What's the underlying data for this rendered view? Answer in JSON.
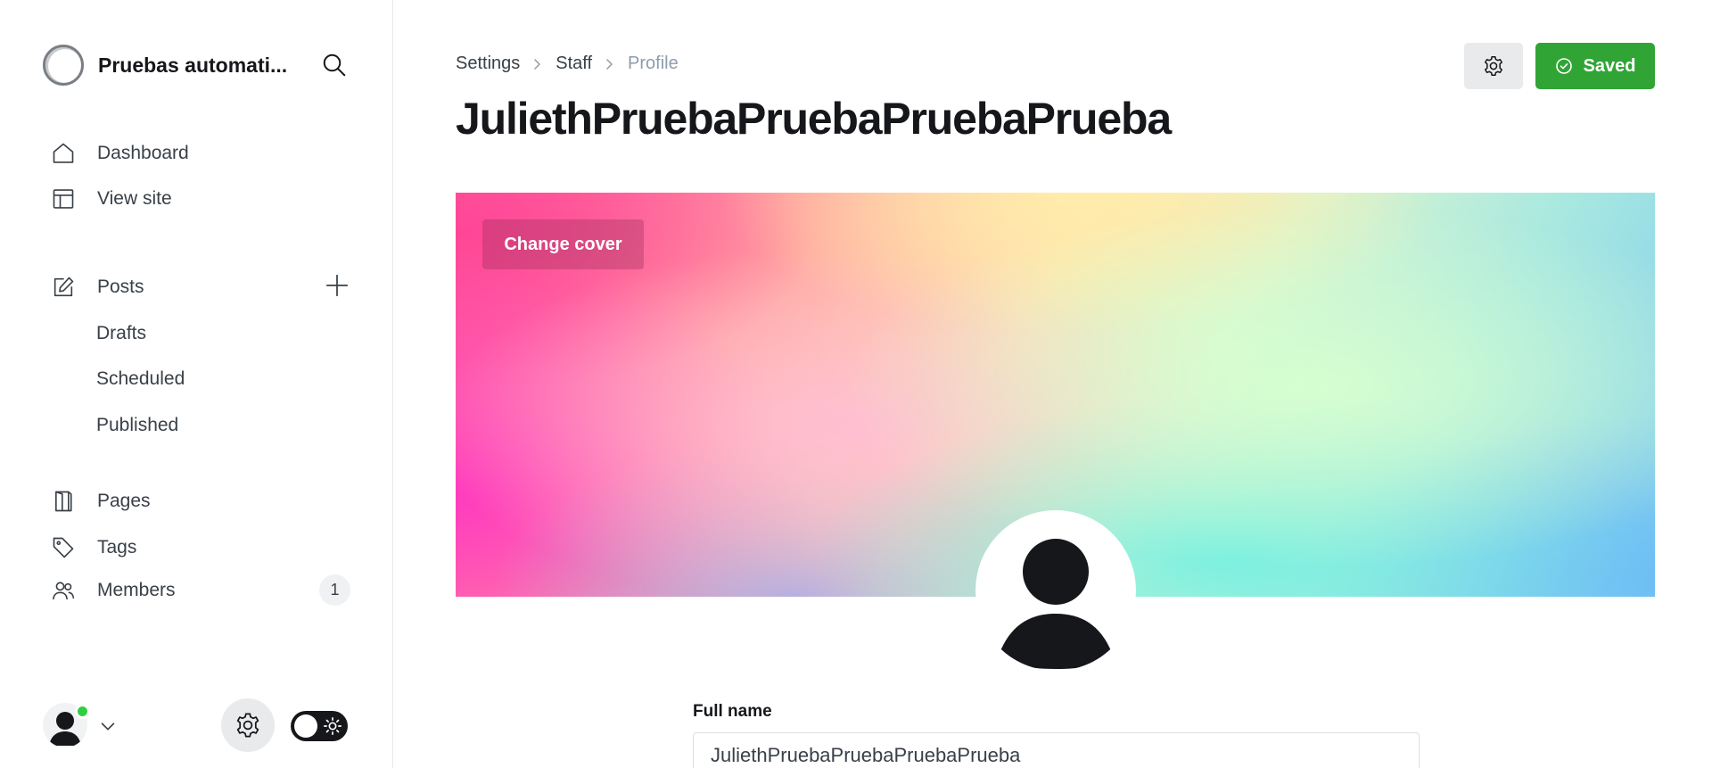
{
  "sidebar": {
    "brand_name": "Pruebas automati...",
    "nav": {
      "dashboard": "Dashboard",
      "view_site": "View site",
      "posts": "Posts",
      "drafts": "Drafts",
      "scheduled": "Scheduled",
      "published": "Published",
      "pages": "Pages",
      "tags": "Tags",
      "members": "Members",
      "members_count": "1"
    },
    "icons": {
      "search": "search-icon",
      "dashboard": "home-icon",
      "view_site": "layout-icon",
      "posts": "edit-icon",
      "add": "plus-icon",
      "pages": "page-icon",
      "tags": "tag-icon",
      "members": "users-icon",
      "settings": "gear-icon",
      "theme": "sun-icon"
    }
  },
  "header": {
    "breadcrumb": [
      "Settings",
      "Staff",
      "Profile"
    ],
    "title": "JuliethPruebaPruebaPruebaPrueba",
    "saved_label": "Saved"
  },
  "cover": {
    "change_cover_label": "Change cover"
  },
  "form": {
    "full_name_label": "Full name",
    "full_name_value": "JuliethPruebaPruebaPruebaPrueba"
  },
  "colors": {
    "saved_green": "#30a535",
    "online_dot": "#30cf43",
    "text_primary": "#15171a",
    "text_muted": "#8e9cac"
  }
}
